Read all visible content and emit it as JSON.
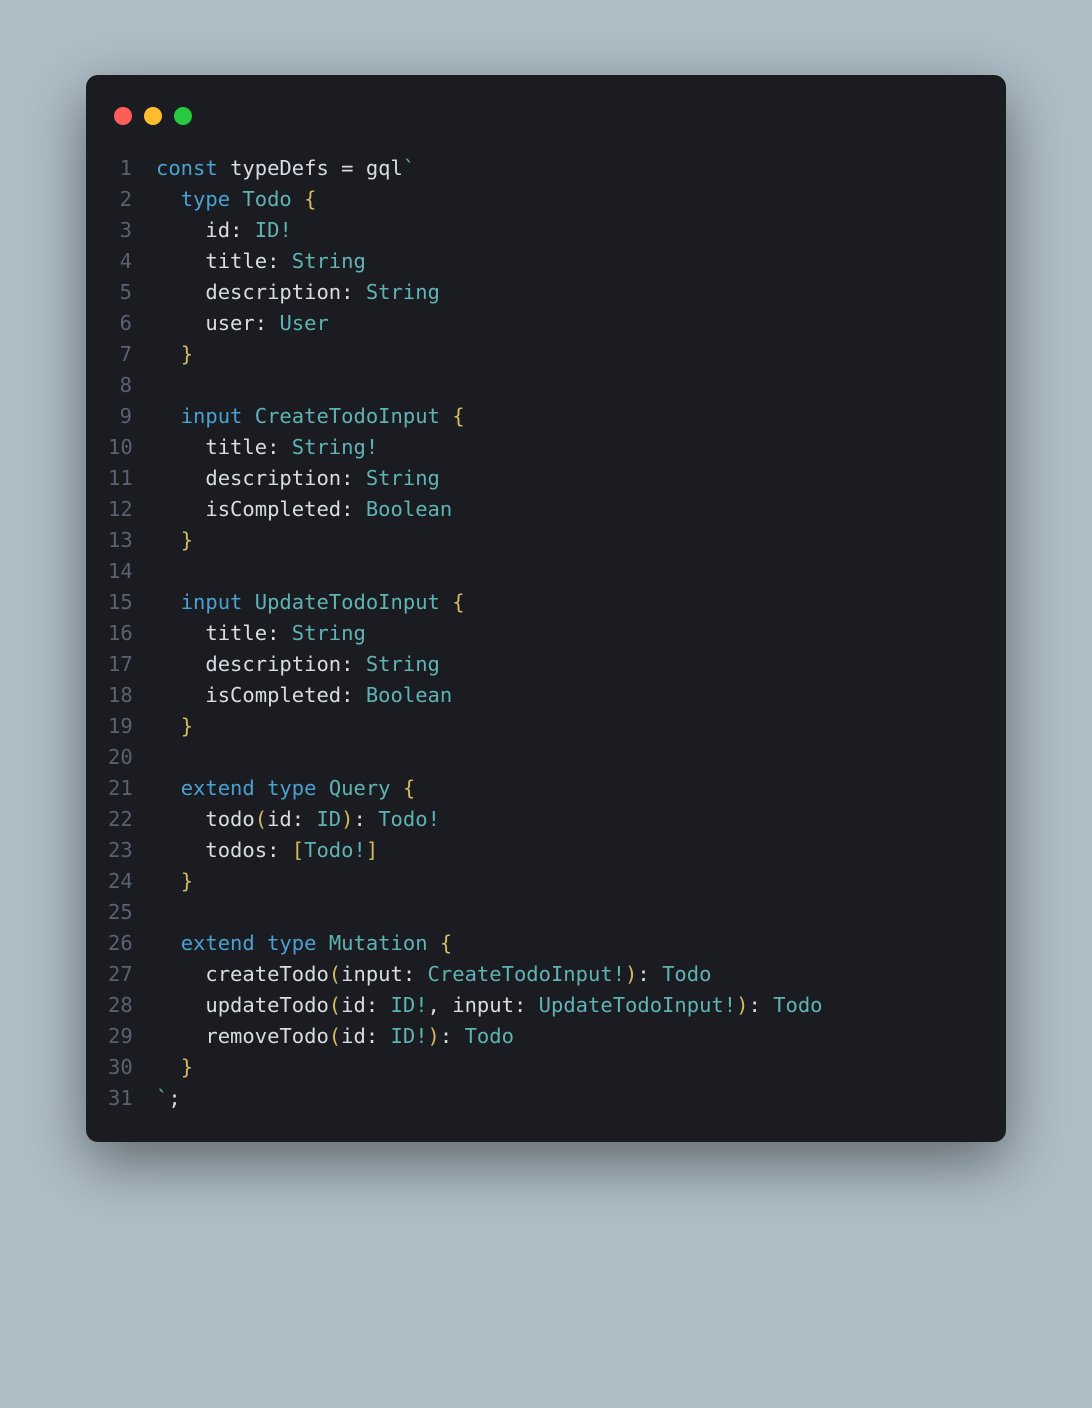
{
  "window": {
    "dots": [
      "red",
      "yellow",
      "green"
    ]
  },
  "code": {
    "lines": [
      [
        {
          "t": "const ",
          "c": "kw"
        },
        {
          "t": "typeDefs ",
          "c": "fn"
        },
        {
          "t": "= ",
          "c": "op"
        },
        {
          "t": "gql",
          "c": "fn"
        },
        {
          "t": "`",
          "c": "tpl"
        }
      ],
      [
        {
          "t": "  ",
          "c": "op"
        },
        {
          "t": "type ",
          "c": "kw"
        },
        {
          "t": "Todo ",
          "c": "typeN"
        },
        {
          "t": "{",
          "c": "brace"
        }
      ],
      [
        {
          "t": "    id",
          "c": "field"
        },
        {
          "t": ": ",
          "c": "op"
        },
        {
          "t": "ID",
          "c": "typeN"
        },
        {
          "t": "!",
          "c": "bang"
        }
      ],
      [
        {
          "t": "    title",
          "c": "field"
        },
        {
          "t": ": ",
          "c": "op"
        },
        {
          "t": "String",
          "c": "typeN"
        }
      ],
      [
        {
          "t": "    description",
          "c": "field"
        },
        {
          "t": ": ",
          "c": "op"
        },
        {
          "t": "String",
          "c": "typeN"
        }
      ],
      [
        {
          "t": "    user",
          "c": "field"
        },
        {
          "t": ": ",
          "c": "op"
        },
        {
          "t": "User",
          "c": "typeN"
        }
      ],
      [
        {
          "t": "  ",
          "c": "op"
        },
        {
          "t": "}",
          "c": "brace"
        }
      ],
      [
        {
          "t": "",
          "c": "op"
        }
      ],
      [
        {
          "t": "  ",
          "c": "op"
        },
        {
          "t": "input ",
          "c": "kw"
        },
        {
          "t": "CreateTodoInput ",
          "c": "typeN"
        },
        {
          "t": "{",
          "c": "brace"
        }
      ],
      [
        {
          "t": "    title",
          "c": "field"
        },
        {
          "t": ": ",
          "c": "op"
        },
        {
          "t": "String",
          "c": "typeN"
        },
        {
          "t": "!",
          "c": "bang"
        }
      ],
      [
        {
          "t": "    description",
          "c": "field"
        },
        {
          "t": ": ",
          "c": "op"
        },
        {
          "t": "String",
          "c": "typeN"
        }
      ],
      [
        {
          "t": "    isCompleted",
          "c": "field"
        },
        {
          "t": ": ",
          "c": "op"
        },
        {
          "t": "Boolean",
          "c": "typeN"
        }
      ],
      [
        {
          "t": "  ",
          "c": "op"
        },
        {
          "t": "}",
          "c": "brace"
        }
      ],
      [
        {
          "t": "",
          "c": "op"
        }
      ],
      [
        {
          "t": "  ",
          "c": "op"
        },
        {
          "t": "input ",
          "c": "kw"
        },
        {
          "t": "UpdateTodoInput ",
          "c": "typeN"
        },
        {
          "t": "{",
          "c": "brace"
        }
      ],
      [
        {
          "t": "    title",
          "c": "field"
        },
        {
          "t": ": ",
          "c": "op"
        },
        {
          "t": "String",
          "c": "typeN"
        }
      ],
      [
        {
          "t": "    description",
          "c": "field"
        },
        {
          "t": ": ",
          "c": "op"
        },
        {
          "t": "String",
          "c": "typeN"
        }
      ],
      [
        {
          "t": "    isCompleted",
          "c": "field"
        },
        {
          "t": ": ",
          "c": "op"
        },
        {
          "t": "Boolean",
          "c": "typeN"
        }
      ],
      [
        {
          "t": "  ",
          "c": "op"
        },
        {
          "t": "}",
          "c": "brace"
        }
      ],
      [
        {
          "t": "",
          "c": "op"
        }
      ],
      [
        {
          "t": "  ",
          "c": "op"
        },
        {
          "t": "extend ",
          "c": "kw"
        },
        {
          "t": "type ",
          "c": "kw"
        },
        {
          "t": "Query ",
          "c": "typeN"
        },
        {
          "t": "{",
          "c": "brace"
        }
      ],
      [
        {
          "t": "    todo",
          "c": "field"
        },
        {
          "t": "(",
          "c": "paren"
        },
        {
          "t": "id",
          "c": "field"
        },
        {
          "t": ": ",
          "c": "op"
        },
        {
          "t": "ID",
          "c": "typeN"
        },
        {
          "t": ")",
          "c": "paren"
        },
        {
          "t": ": ",
          "c": "op"
        },
        {
          "t": "Todo",
          "c": "typeN"
        },
        {
          "t": "!",
          "c": "bang"
        }
      ],
      [
        {
          "t": "    todos",
          "c": "field"
        },
        {
          "t": ": ",
          "c": "op"
        },
        {
          "t": "[",
          "c": "paren"
        },
        {
          "t": "Todo",
          "c": "typeN"
        },
        {
          "t": "!",
          "c": "bang"
        },
        {
          "t": "]",
          "c": "paren"
        }
      ],
      [
        {
          "t": "  ",
          "c": "op"
        },
        {
          "t": "}",
          "c": "brace"
        }
      ],
      [
        {
          "t": "",
          "c": "op"
        }
      ],
      [
        {
          "t": "  ",
          "c": "op"
        },
        {
          "t": "extend ",
          "c": "kw"
        },
        {
          "t": "type ",
          "c": "kw"
        },
        {
          "t": "Mutation ",
          "c": "typeN"
        },
        {
          "t": "{",
          "c": "brace"
        }
      ],
      [
        {
          "t": "    createTodo",
          "c": "field"
        },
        {
          "t": "(",
          "c": "paren"
        },
        {
          "t": "input",
          "c": "field"
        },
        {
          "t": ": ",
          "c": "op"
        },
        {
          "t": "CreateTodoInput",
          "c": "typeN"
        },
        {
          "t": "!",
          "c": "bang"
        },
        {
          "t": ")",
          "c": "paren"
        },
        {
          "t": ": ",
          "c": "op"
        },
        {
          "t": "Todo",
          "c": "typeN"
        }
      ],
      [
        {
          "t": "    updateTodo",
          "c": "field"
        },
        {
          "t": "(",
          "c": "paren"
        },
        {
          "t": "id",
          "c": "field"
        },
        {
          "t": ": ",
          "c": "op"
        },
        {
          "t": "ID",
          "c": "typeN"
        },
        {
          "t": "!",
          "c": "bang"
        },
        {
          "t": ", ",
          "c": "op"
        },
        {
          "t": "input",
          "c": "field"
        },
        {
          "t": ": ",
          "c": "op"
        },
        {
          "t": "UpdateTodoInput",
          "c": "typeN"
        },
        {
          "t": "!",
          "c": "bang"
        },
        {
          "t": ")",
          "c": "paren"
        },
        {
          "t": ": ",
          "c": "op"
        },
        {
          "t": "Todo",
          "c": "typeN"
        }
      ],
      [
        {
          "t": "    removeTodo",
          "c": "field"
        },
        {
          "t": "(",
          "c": "paren"
        },
        {
          "t": "id",
          "c": "field"
        },
        {
          "t": ": ",
          "c": "op"
        },
        {
          "t": "ID",
          "c": "typeN"
        },
        {
          "t": "!",
          "c": "bang"
        },
        {
          "t": ")",
          "c": "paren"
        },
        {
          "t": ": ",
          "c": "op"
        },
        {
          "t": "Todo",
          "c": "typeN"
        }
      ],
      [
        {
          "t": "  ",
          "c": "op"
        },
        {
          "t": "}",
          "c": "brace"
        }
      ],
      [
        {
          "t": "`",
          "c": "tpl"
        },
        {
          "t": ";",
          "c": "op"
        }
      ]
    ]
  }
}
